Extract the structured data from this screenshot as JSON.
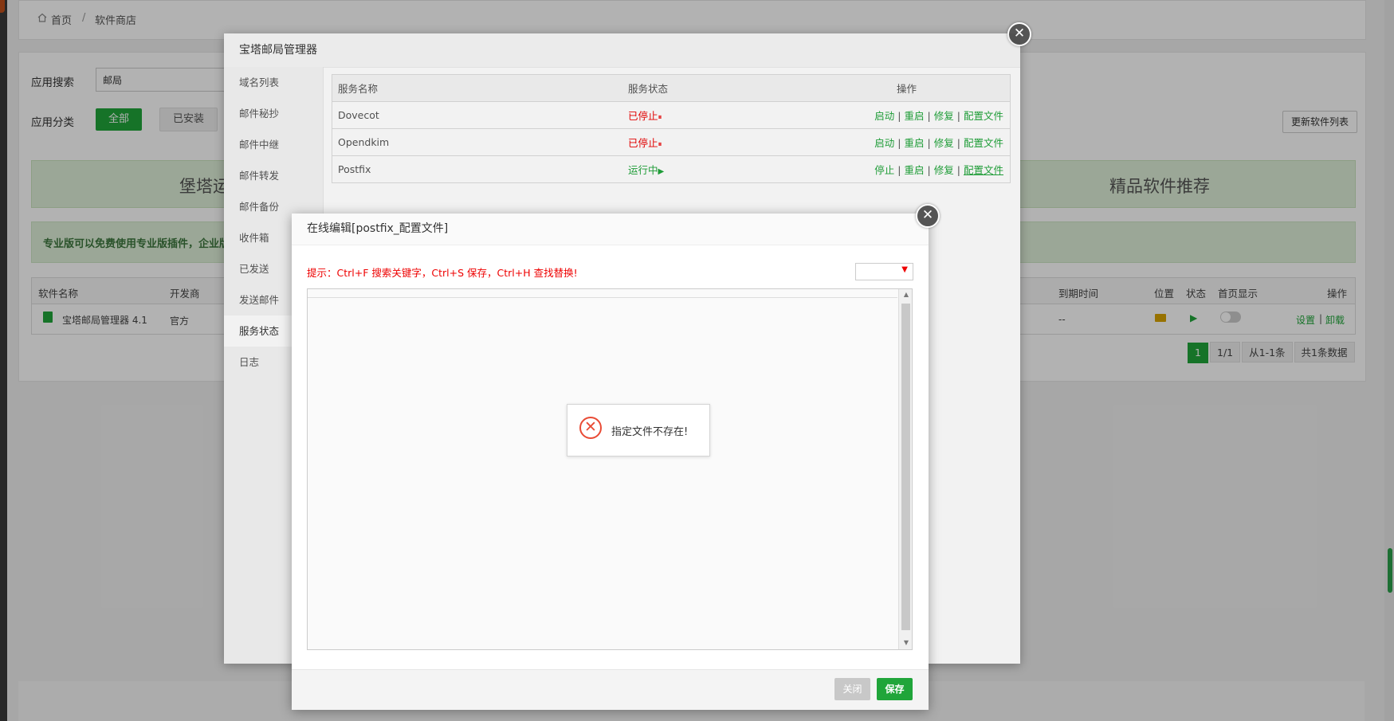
{
  "breadcrumb": {
    "home": "首页",
    "sep": "/",
    "current": "软件商店"
  },
  "search": {
    "label": "应用搜索",
    "value": "邮局"
  },
  "category": {
    "label": "应用分类",
    "all": "全部",
    "installed": "已安装"
  },
  "update_list_button": "更新软件列表",
  "banner_left": "堡塔运",
  "banner_right": "精品软件推荐",
  "pro_hint": "专业版可以免费使用专业版插件，企业版",
  "software_table": {
    "headers": {
      "name": "软件名称",
      "dev": "开发商",
      "expire": "到期时间",
      "location": "位置",
      "status": "状态",
      "homepage": "首页显示",
      "ops": "操作"
    },
    "row": {
      "name": "宝塔邮局管理器 4.1",
      "dev": "官方",
      "expire": "--",
      "settings": "设置",
      "uninstall": "卸载",
      "sep": "|"
    }
  },
  "pagination": {
    "current": "1",
    "pages": "1/1",
    "range": "从1-1条",
    "total": "共1条数据"
  },
  "mail_modal": {
    "title": "宝塔邮局管理器",
    "sidebar": [
      "域名列表",
      "邮件秘抄",
      "邮件中继",
      "邮件转发",
      "邮件备份",
      "收件箱",
      "已发送",
      "发送邮件",
      "服务状态",
      "日志"
    ],
    "active_index": 8,
    "service_table": {
      "headers": {
        "name": "服务名称",
        "status": "服务状态",
        "ops": "操作"
      },
      "rows": [
        {
          "name": "Dovecot",
          "status": "已停止",
          "status_icon": "⏸",
          "op1": "启动",
          "op2": "重启",
          "op3": "修复",
          "op4": "配置文件"
        },
        {
          "name": "Opendkim",
          "status": "已停止",
          "status_icon": "⏸",
          "op1": "启动",
          "op2": "重启",
          "op3": "修复",
          "op4": "配置文件"
        },
        {
          "name": "Postfix",
          "status": "运行中",
          "status_icon": "▶",
          "op1": "停止",
          "op2": "重启",
          "op3": "修复",
          "op4": "配置文件"
        }
      ],
      "sep": "|"
    }
  },
  "edit_modal": {
    "title": "在线编辑[postfix_配置文件]",
    "tip": "提示：Ctrl+F 搜索关键字，Ctrl+S 保存，Ctrl+H 查找替换!",
    "encoding_value": "",
    "error_message": "指定文件不存在!",
    "close_button": "关闭",
    "save_button": "保存"
  },
  "colors": {
    "brand_green": "#20a53a",
    "error_red": "#e94b35",
    "stopped_red": "#ee0000"
  }
}
